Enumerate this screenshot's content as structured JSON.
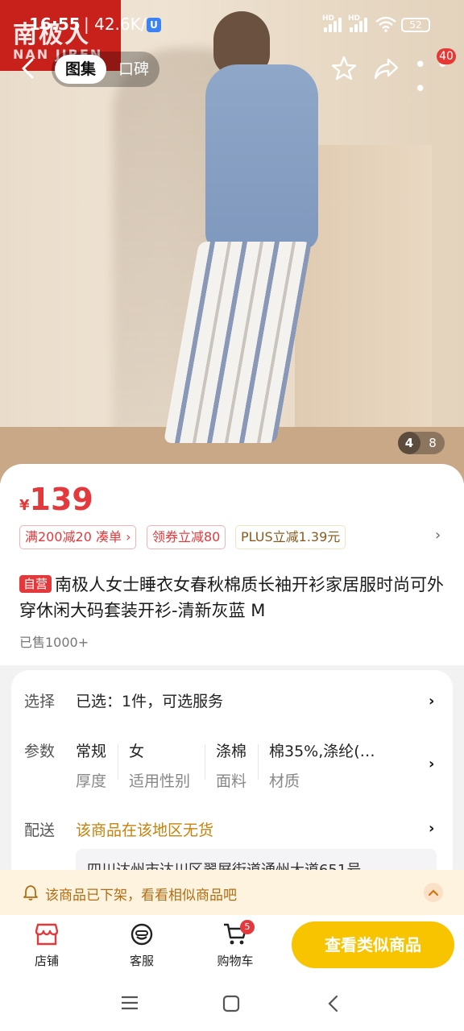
{
  "status_bar": {
    "time": "16:55",
    "speed": "| 42.6K/s",
    "battery": "52"
  },
  "brand_logo": {
    "line1": "南极人",
    "line2": "NAN JIREN"
  },
  "nav": {
    "tab_gallery": "图集",
    "tab_reviews": "口碑",
    "more_badge": "40"
  },
  "gallery_pager": {
    "current": "4",
    "total": "8"
  },
  "product": {
    "price_currency": "¥",
    "price": "139",
    "promos": [
      {
        "label": "满200减20  凑单 ›"
      },
      {
        "label": "领券立减80"
      },
      {
        "label": "PLUS立减1.39元"
      }
    ],
    "promo_more": "›",
    "tag": "自营",
    "title": "南极人女士睡衣女春秋棉质长袖开衫家居服时尚可外穿休闲大码套装开衫-清新灰蓝 M",
    "sold": "已售1000+"
  },
  "spec": {
    "select_label": "选择",
    "select_value": "已选：1件，可选服务",
    "params_label": "参数",
    "params": [
      {
        "value": "常规",
        "key": "厚度"
      },
      {
        "value": "女",
        "key": "适用性别"
      },
      {
        "value": "涤棉",
        "key": "面料"
      },
      {
        "value": "棉35%,涤纶(…",
        "key": "材质"
      }
    ],
    "delivery_label": "配送",
    "delivery_value": "该商品在该地区无货",
    "address": "四川达州市达川区翠屏街道通州大道651号",
    "chevron": "›"
  },
  "notice": {
    "text": "该商品已下架，看看相似商品吧",
    "color": "#b26d12"
  },
  "bottom_bar": {
    "shop": "店铺",
    "service": "客服",
    "cart": "购物车",
    "cart_count": "5",
    "cta": "查看类似商品",
    "cta_color": "#f8c400"
  },
  "colors": {
    "price_red": "#e4393c",
    "delivery_orange": "#c8820b"
  }
}
